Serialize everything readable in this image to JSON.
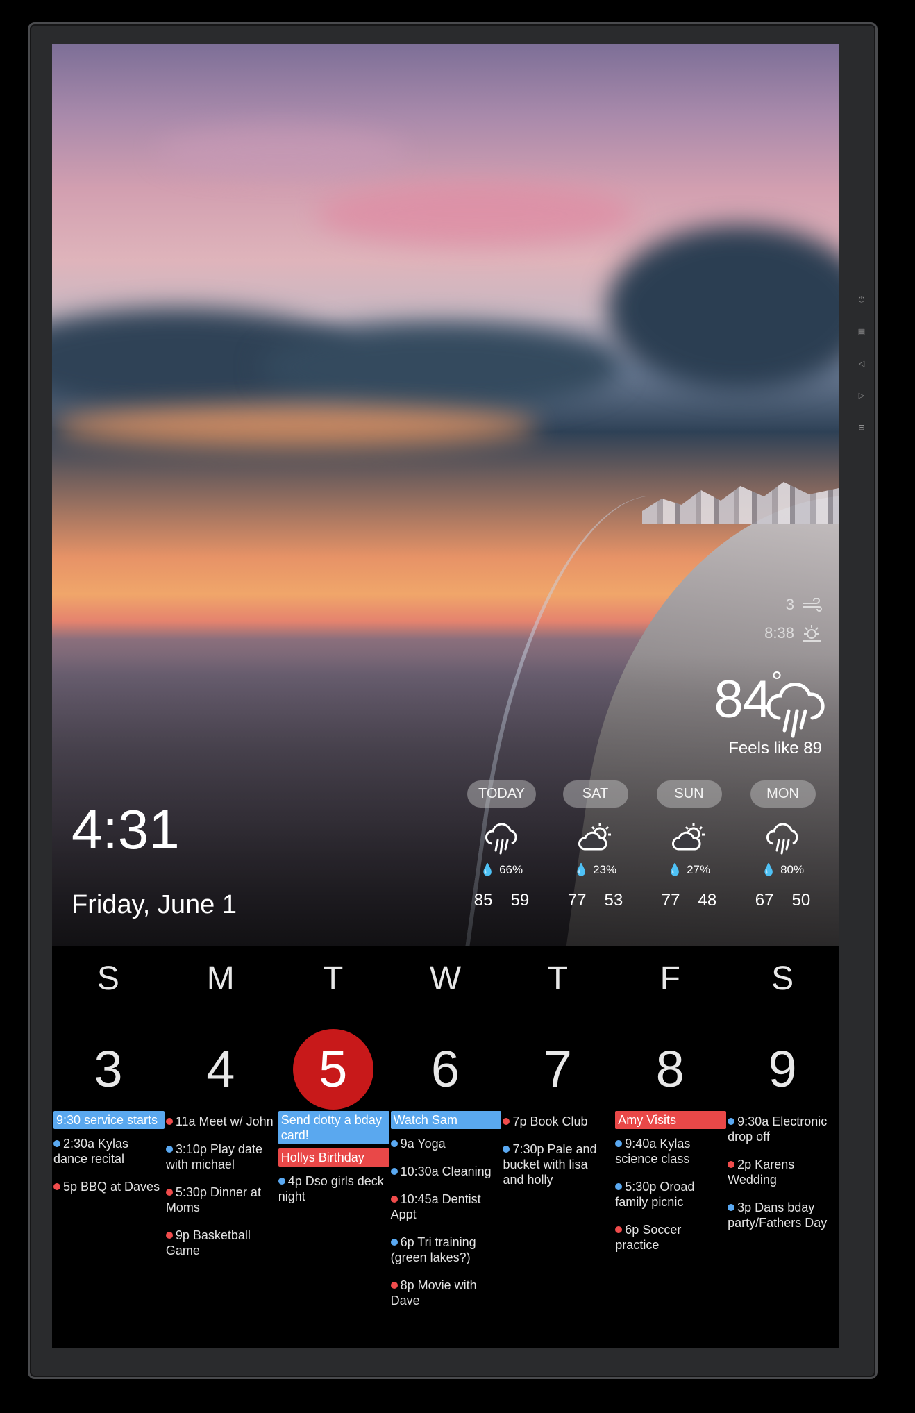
{
  "weather": {
    "wind": "3",
    "sunrise": "8:38",
    "temperature": "84",
    "degree_symbol": "°",
    "feels_like": "Feels like 89",
    "forecast": [
      {
        "day": "TODAY",
        "icon": "rain-icon",
        "precip": "66%",
        "high": "85",
        "low": "59"
      },
      {
        "day": "SAT",
        "icon": "partly-sunny-icon",
        "precip": "23%",
        "high": "77",
        "low": "53"
      },
      {
        "day": "SUN",
        "icon": "partly-sunny-icon",
        "precip": "27%",
        "high": "77",
        "low": "48"
      },
      {
        "day": "MON",
        "icon": "rain-icon",
        "precip": "80%",
        "high": "67",
        "low": "50"
      }
    ]
  },
  "clock": {
    "time": "4:31",
    "date": "Friday,  June 1"
  },
  "calendar": {
    "weekdays": [
      "S",
      "M",
      "T",
      "W",
      "T",
      "F",
      "S"
    ],
    "dates": [
      "3",
      "4",
      "5",
      "6",
      "7",
      "8",
      "9"
    ],
    "today_index": 2,
    "colors": {
      "red": "#f04c4c",
      "blue": "#5aa9f2",
      "today": "#c8191a"
    },
    "days": [
      {
        "banners": [
          {
            "text": "9:30 service starts",
            "color": "blue"
          }
        ],
        "events": [
          {
            "text": "2:30a Kylas dance recital",
            "color": "blue"
          },
          {
            "text": "5p BBQ at Daves",
            "color": "red"
          }
        ]
      },
      {
        "banners": [],
        "events": [
          {
            "text": "11a Meet w/ John",
            "color": "red"
          },
          {
            "text": "3:10p Play date with michael",
            "color": "blue"
          },
          {
            "text": "5:30p Dinner at Moms",
            "color": "red"
          },
          {
            "text": "9p Basketball Game",
            "color": "red"
          }
        ]
      },
      {
        "banners": [
          {
            "text": "Send dotty a bday card!",
            "color": "blue"
          },
          {
            "text": "Hollys Birthday",
            "color": "red"
          }
        ],
        "events": [
          {
            "text": "4p Dso girls deck night",
            "color": "blue"
          }
        ]
      },
      {
        "banners": [
          {
            "text": "Watch Sam",
            "color": "blue"
          }
        ],
        "events": [
          {
            "text": "9a Yoga",
            "color": "blue"
          },
          {
            "text": "10:30a Cleaning",
            "color": "blue"
          },
          {
            "text": "10:45a Dentist Appt",
            "color": "red"
          },
          {
            "text": "6p Tri training (green lakes?)",
            "color": "blue"
          },
          {
            "text": "8p Movie with Dave",
            "color": "red"
          }
        ]
      },
      {
        "banners": [],
        "events": [
          {
            "text": "7p Book Club",
            "color": "red"
          },
          {
            "text": "7:30p Pale and bucket with lisa and holly",
            "color": "blue"
          }
        ]
      },
      {
        "banners": [
          {
            "text": "Amy Visits",
            "color": "red"
          }
        ],
        "events": [
          {
            "text": "9:40a Kylas science class",
            "color": "blue"
          },
          {
            "text": "5:30p Oroad family picnic",
            "color": "blue"
          },
          {
            "text": "6p Soccer practice",
            "color": "red"
          }
        ]
      },
      {
        "banners": [],
        "events": [
          {
            "text": "9:30a Electronic drop off",
            "color": "blue"
          },
          {
            "text": "2p Karens Wedding",
            "color": "red"
          },
          {
            "text": "3p Dans bday party/Fathers Day",
            "color": "blue"
          }
        ]
      }
    ]
  },
  "device": {
    "side_buttons": [
      "power-icon",
      "menu-icon",
      "volume-down-icon",
      "volume-up-icon",
      "input-icon"
    ]
  }
}
